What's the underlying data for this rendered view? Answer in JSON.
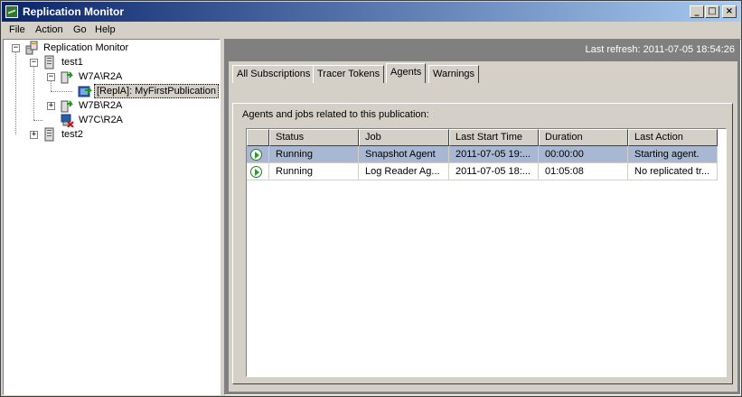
{
  "window": {
    "title": "Replication Monitor"
  },
  "menu": {
    "items": [
      "File",
      "Action",
      "Go",
      "Help"
    ]
  },
  "tree": {
    "nodes": [
      {
        "label": "Replication Monitor",
        "expander": "−"
      },
      {
        "label": "test1",
        "expander": "−"
      },
      {
        "label": "W7A\\R2A",
        "expander": "−"
      },
      {
        "label": "[ReplA]: MyFirstPublication"
      },
      {
        "label": "W7B\\R2A",
        "expander": "+"
      },
      {
        "label": "W7C\\R2A"
      },
      {
        "label": "test2",
        "expander": "+"
      }
    ]
  },
  "refresh": {
    "text": "Last refresh: 2011-07-05 18:54:26"
  },
  "tabs": [
    "All Subscriptions",
    "Tracer Tokens",
    "Agents",
    "Warnings"
  ],
  "active_tab": "Agents",
  "panel": {
    "caption": "Agents and jobs related to this publication:"
  },
  "grid": {
    "columns": [
      "Status",
      "Job",
      "Last Start Time",
      "Duration",
      "Last Action"
    ],
    "rows": [
      {
        "status": "Running",
        "job": "Snapshot Agent",
        "last_start": "2011-07-05 19:...",
        "duration": "00:00:00",
        "last_action": "Starting agent.",
        "selected": true
      },
      {
        "status": "Running",
        "job": "Log Reader Ag...",
        "last_start": "2011-07-05 18:...",
        "duration": "01:05:08",
        "last_action": "No replicated tr...",
        "selected": false
      }
    ]
  }
}
